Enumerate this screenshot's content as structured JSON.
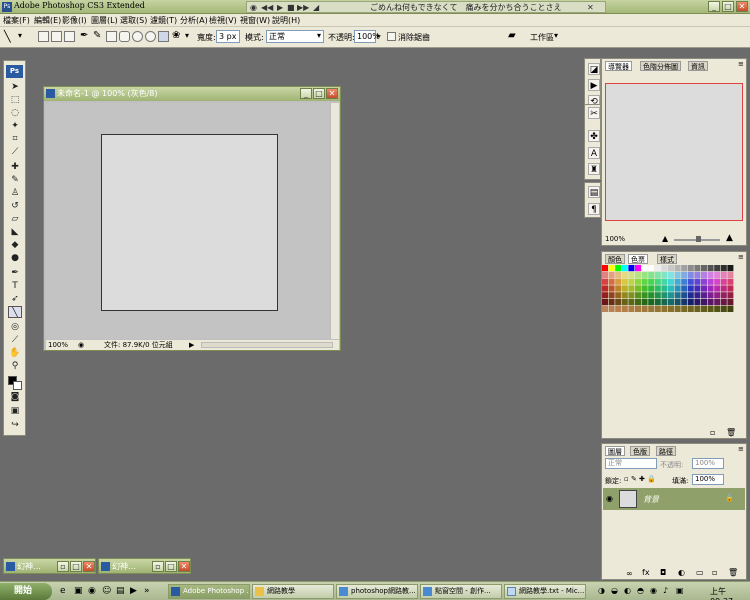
{
  "window": {
    "title": "Adobe Photoshop CS3 Extended",
    "ps_logo": "Ps"
  },
  "media": {
    "lyric": "ごめんね何もできなくて　痛みを分かち合うことさえ"
  },
  "menu": [
    "檔案(F)",
    "編輯(E)",
    "影像(I)",
    "圖層(L)",
    "選取(S)",
    "濾鏡(T)",
    "分析(A)",
    "檢視(V)",
    "視窗(W)",
    "說明(H)"
  ],
  "options": {
    "weight_label": "寬度:",
    "weight_value": "3 px",
    "mode_label": "模式:",
    "mode_value": "正常",
    "opacity_label": "不透明:",
    "opacity_value": "100%",
    "antialias_label": "消除鋸齒",
    "workspace_label": "工作區"
  },
  "document": {
    "title": "未命名-1 @ 100% (灰色/8)",
    "zoom": "100%",
    "status": "文件: 87.9K/0 位元組"
  },
  "navigator": {
    "tabs": [
      "導覽器",
      "色階分佈圖",
      "資訊"
    ],
    "zoom": "100%"
  },
  "color_panel": {
    "tabs": [
      "顏色",
      "色票",
      "樣式"
    ]
  },
  "layers": {
    "tabs": [
      "圖層",
      "色版",
      "路徑"
    ],
    "mode_value": "正常",
    "opacity_label": "不透明:",
    "opacity_value": "100%",
    "lock_label": "鎖定:",
    "fill_label": "填滿:",
    "fill_value": "100%",
    "layer_name": "背景"
  },
  "minimized": [
    "幻神…",
    "幻神…"
  ],
  "taskbar": {
    "start_label": "開始",
    "tasks": [
      "Adobe Photoshop ...",
      "網路教學",
      "photoshop網路教...",
      "點窗空間 - 創作...",
      "網路教學.txt - Mic..."
    ],
    "clock": "上午 09:37"
  },
  "colors": {
    "titlebar": "#a4b878",
    "accent_red": "#e04040",
    "layer_row": "#8fa06a"
  }
}
